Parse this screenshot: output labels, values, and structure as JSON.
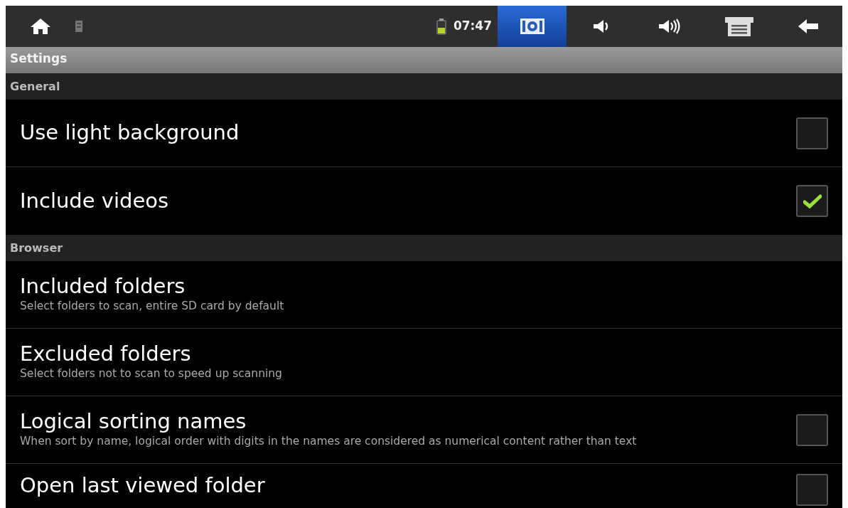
{
  "status_bar": {
    "time": "07:47",
    "nav_buttons": [
      {
        "kind": "screenshot",
        "selected": true
      },
      {
        "kind": "volume-down",
        "selected": false
      },
      {
        "kind": "volume-up",
        "selected": false
      },
      {
        "kind": "menu",
        "selected": false
      },
      {
        "kind": "back",
        "selected": false
      }
    ]
  },
  "title": "Settings",
  "sections": [
    {
      "title": "General",
      "items": [
        {
          "kind": "checkbox",
          "title": "Use light background",
          "checked": false
        },
        {
          "kind": "checkbox",
          "title": "Include videos",
          "checked": true
        }
      ]
    },
    {
      "title": "Browser",
      "items": [
        {
          "kind": "plain",
          "title": "Included folders",
          "summary": "Select folders to scan, entire SD card by default"
        },
        {
          "kind": "plain",
          "title": "Excluded folders",
          "summary": "Select folders not to scan to speed up scanning"
        },
        {
          "kind": "checkbox",
          "title": "Logical sorting names",
          "summary": "When sort by name, logical order with digits in the names are considered as numerical content rather than text",
          "checked": false
        },
        {
          "kind": "checkbox",
          "title": "Open last viewed folder",
          "checked": false
        }
      ]
    }
  ]
}
